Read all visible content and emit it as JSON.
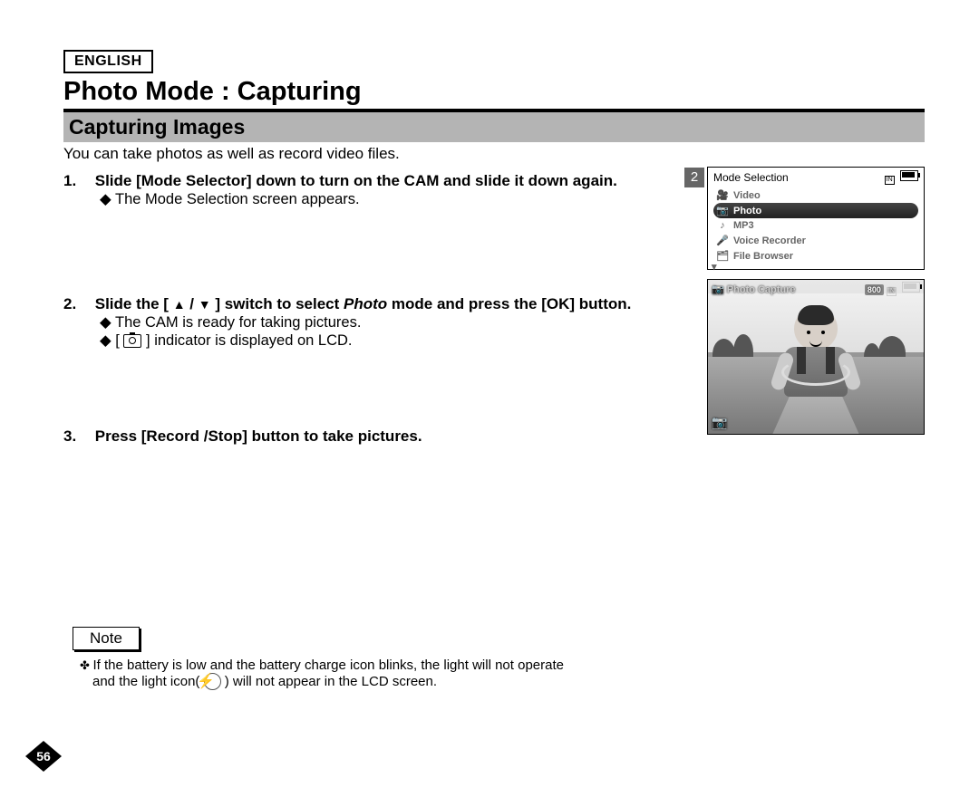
{
  "language": "ENGLISH",
  "title": "Photo Mode : Capturing",
  "subtitle": "Capturing Images",
  "intro": "You can take photos as well as record video files.",
  "steps": [
    {
      "num": "1.",
      "text_a": "Slide [Mode Selector] down to turn on the CAM and slide it down again.",
      "subs": [
        "The Mode Selection screen appears."
      ]
    },
    {
      "num": "2.",
      "text_a": "Slide the [ ",
      "text_b": " / ",
      "text_c": " ] switch to select ",
      "text_em": "Photo",
      "text_d": " mode and press the [OK] button.",
      "subs": [
        "The CAM is ready for taking pictures.",
        "[   ] indicator is displayed on LCD."
      ]
    },
    {
      "num": "3.",
      "text_a": "Press [Record /Stop] button to take pictures.",
      "subs": []
    }
  ],
  "screen_badge": "2",
  "mode_screen": {
    "title": "Mode Selection",
    "items": [
      "Video",
      "Photo",
      "MP3",
      "Voice Recorder",
      "File Browser"
    ],
    "selected": "Photo"
  },
  "capture_screen": {
    "title": "Photo Capture",
    "res": "800"
  },
  "note_label": "Note",
  "notes": {
    "line1": "If the battery is low and the battery charge icon blinks, the light will not operate",
    "line2_a": "and the light icon( ",
    "line2_b": " ) will not appear in the LCD screen."
  },
  "page_number": "56"
}
